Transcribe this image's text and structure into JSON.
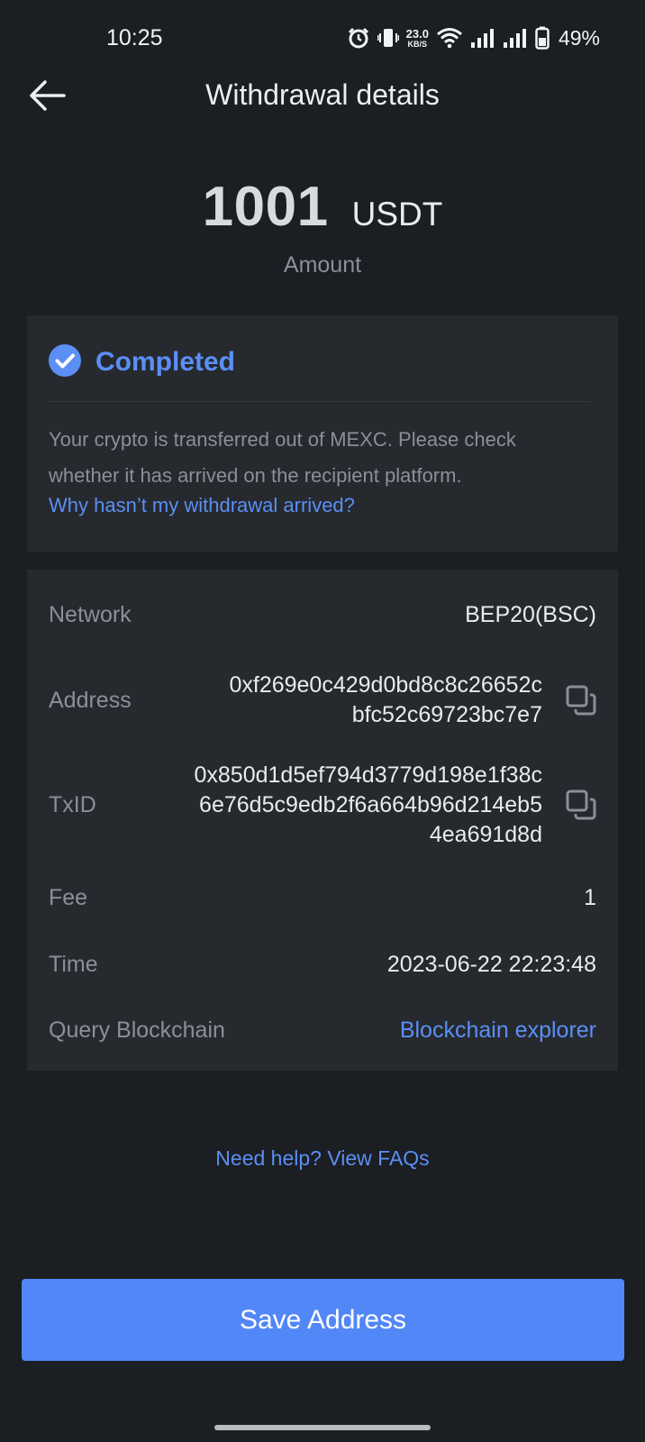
{
  "status_bar": {
    "time": "10:25",
    "net_speed_value": "23.0",
    "net_speed_unit": "KB/S",
    "battery": "49%",
    "icons": [
      "alarm-icon",
      "vibrate-icon",
      "wifi-icon",
      "signal-icon",
      "signal-icon",
      "battery-icon"
    ]
  },
  "header": {
    "title": "Withdrawal details",
    "back_icon": "arrow-left-icon"
  },
  "amount": {
    "value": "1001",
    "unit": "USDT",
    "label": "Amount"
  },
  "status": {
    "icon": "check-circle-icon",
    "text": "Completed",
    "description": "Your crypto is transferred out of MEXC. Please check whether it has arrived on the recipient platform.",
    "link": "Why hasn’t my withdrawal arrived?"
  },
  "details": {
    "network": {
      "label": "Network",
      "value": "BEP20(BSC)"
    },
    "address": {
      "label": "Address",
      "line1": "0xf269e0c429d0bd8c8c26652c",
      "line2": "bfc52c69723bc7e7"
    },
    "txid": {
      "label": "TxID",
      "line1": "0x850d1d5ef794d3779d198e1f38c",
      "line2": "6e76d5c9edb2f6a664b96d214eb5",
      "line3": "4ea691d8d"
    },
    "fee": {
      "label": "Fee",
      "value": "1"
    },
    "time": {
      "label": "Time",
      "value": "2023-06-22 22:23:48"
    },
    "query": {
      "label": "Query Blockchain",
      "link": "Blockchain explorer"
    }
  },
  "help_link": "Need help? View FAQs",
  "save_button": "Save Address",
  "colors": {
    "background": "#1b1e22",
    "card": "#26292e",
    "accent": "#5b8ff5",
    "button": "#5187f7",
    "muted_text": "#8a9099"
  }
}
